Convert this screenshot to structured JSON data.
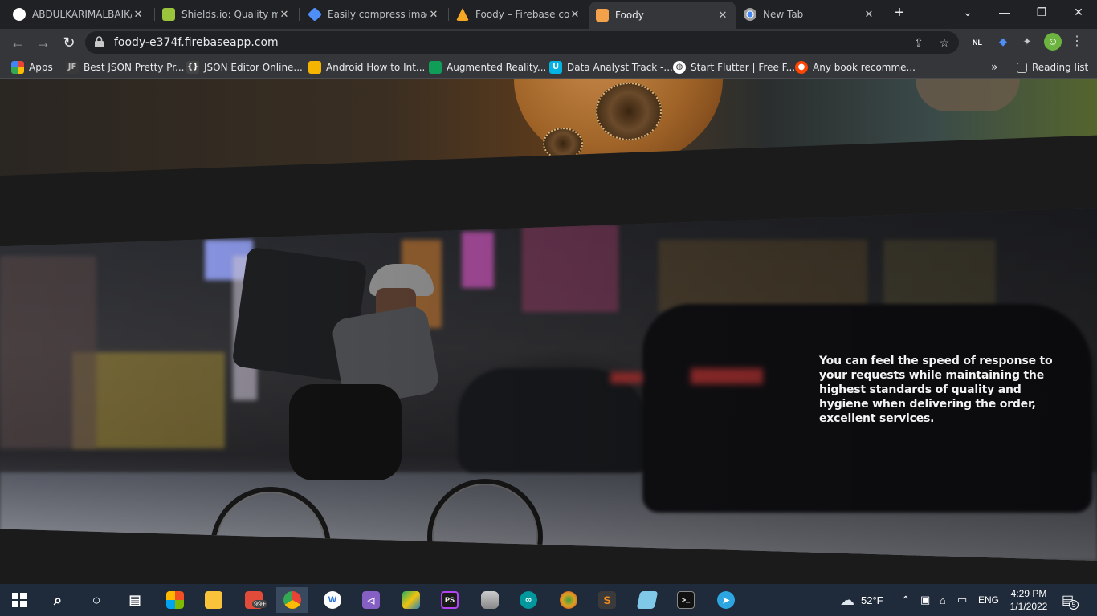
{
  "browser": {
    "tabs": [
      {
        "title": "ABDULKARIMALBAIK/",
        "icon": "github-icon",
        "color": "#ffffff"
      },
      {
        "title": "Shields.io: Quality met",
        "icon": "shields-icon",
        "color": "#9ac43b"
      },
      {
        "title": "Easily compress image",
        "icon": "compress-icon",
        "color": "#4f8ef7"
      },
      {
        "title": "Foody – Firebase cons",
        "icon": "firebase-icon",
        "color": "#f5a623"
      },
      {
        "title": "Foody",
        "icon": "foody-icon",
        "color": "#f3a14a",
        "active": true
      },
      {
        "title": "New Tab",
        "icon": "chrome-icon",
        "color": "#ffffff"
      }
    ],
    "url": "foody-e374f.firebaseapp.com",
    "bookmarks": [
      {
        "label": "Apps",
        "icon": "apps-grid-icon",
        "color": "#ea4335"
      },
      {
        "label": "Best JSON Pretty Pr...",
        "icon": "jf-icon",
        "color": "#333333"
      },
      {
        "label": "JSON Editor Online...",
        "icon": "json-braces-icon",
        "color": "#444444"
      },
      {
        "label": "Android How to Int...",
        "icon": "android-icon",
        "color": "#f4b400"
      },
      {
        "label": "Augmented Reality...",
        "icon": "ar-icon",
        "color": "#0f9d58"
      },
      {
        "label": "Data Analyst Track -...",
        "icon": "udacity-icon",
        "color": "#02b3e4"
      },
      {
        "label": "Start Flutter | Free F...",
        "icon": "globe-icon",
        "color": "#ffffff"
      },
      {
        "label": "Any book recomme...",
        "icon": "reddit-icon",
        "color": "#ff4500"
      }
    ],
    "more_bookmarks": "»",
    "reading_list": "Reading list",
    "extension_badge": "NL"
  },
  "page": {
    "hero_text": "You can feel the speed of response to your requests while maintaining the highest standards of quality and hygiene when delivering the order, excellent services."
  },
  "taskbar": {
    "weather_temp": "52°F",
    "language": "ENG",
    "time": "4:29 PM",
    "date": "1/1/2022",
    "notification_count": "5",
    "badge_count": "99+",
    "apps": [
      {
        "name": "start-icon",
        "color": "#ffffff"
      },
      {
        "name": "search-icon",
        "color": "#ffffff"
      },
      {
        "name": "cortana-icon",
        "color": "#ffffff"
      },
      {
        "name": "task-view-icon",
        "color": "#ffffff"
      },
      {
        "name": "store-icon",
        "color": "#f25022"
      },
      {
        "name": "file-explorer-icon",
        "color": "#f8c23a"
      },
      {
        "name": "app-badge-icon",
        "color": "#e04b3a"
      },
      {
        "name": "chrome-icon",
        "color": "#4285f4"
      },
      {
        "name": "writer-icon",
        "color": "#2b73d6"
      },
      {
        "name": "visual-studio-icon",
        "color": "#865fc5"
      },
      {
        "name": "tool-icon",
        "color": "#27ae60"
      },
      {
        "name": "phpstorm-icon",
        "color": "#b345f1"
      },
      {
        "name": "database-icon",
        "color": "#bbbbbb"
      },
      {
        "name": "arduino-icon",
        "color": "#00979d"
      },
      {
        "name": "swirl-icon",
        "color": "#e0a020"
      },
      {
        "name": "sublime-icon",
        "color": "#f28b20"
      },
      {
        "name": "notebook-icon",
        "color": "#7fc8e8"
      },
      {
        "name": "terminal-icon",
        "color": "#333333"
      },
      {
        "name": "telegram-icon",
        "color": "#2ca5e0"
      }
    ]
  }
}
